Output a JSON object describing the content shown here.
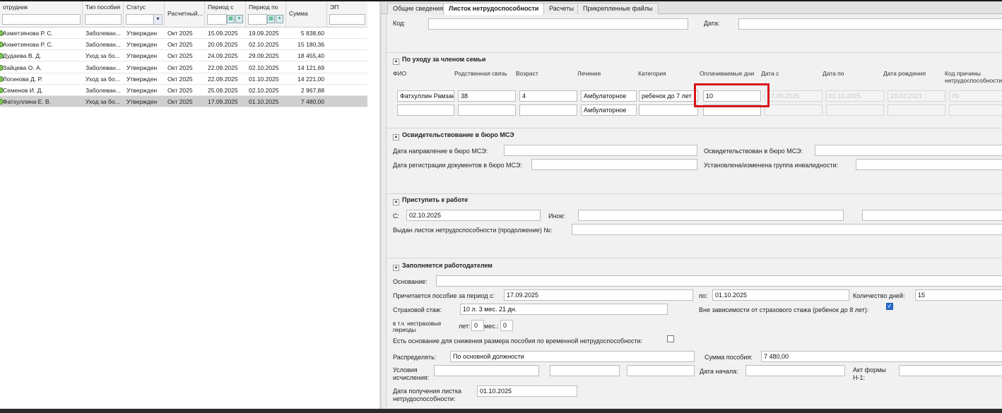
{
  "grid": {
    "columns": [
      "отрудник",
      "Тип пособия",
      "Статус",
      "Расчетный...",
      "Период с",
      "Период по",
      "Сумма",
      "ЭП"
    ],
    "rows": [
      {
        "employee": "Ахметзянова Р. С.",
        "type": "Заболеван...",
        "status": "Утвержден",
        "period": "Окт 2025",
        "from": "15.09.2025",
        "to": "19.09.2025",
        "sum": "5 838,60",
        "selected": false
      },
      {
        "employee": "Ахметзянова Р. С.",
        "type": "Заболеван...",
        "status": "Утвержден",
        "period": "Окт 2025",
        "from": "20.09.2025",
        "to": "02.10.2025",
        "sum": "15 180,36",
        "selected": false
      },
      {
        "employee": "Дудаева В. Д.",
        "type": "Уход за бо...",
        "status": "Утвержден",
        "period": "Окт 2025",
        "from": "24.09.2025",
        "to": "29.09.2025",
        "sum": "18 455,40",
        "selected": false
      },
      {
        "employee": "Зайцева О. А.",
        "type": "Заболеван...",
        "status": "Утвержден",
        "period": "Окт 2025",
        "from": "22.09.2025",
        "to": "02.10.2025",
        "sum": "14 121,69",
        "selected": false
      },
      {
        "employee": "Логинова Д. Р.",
        "type": "Уход за бо...",
        "status": "Утвержден",
        "period": "Окт 2025",
        "from": "22.09.2025",
        "to": "01.10.2025",
        "sum": "14 221,00",
        "selected": false
      },
      {
        "employee": "Семенов И. Д.",
        "type": "Заболеван...",
        "status": "Утвержден",
        "period": "Окт 2025",
        "from": "25.09.2025",
        "to": "02.10.2025",
        "sum": "2 967,88",
        "selected": false
      },
      {
        "employee": "Фатхуллина Е. В.",
        "type": "Уход за бо...",
        "status": "Утвержден",
        "period": "Окт 2025",
        "from": "17.09.2025",
        "to": "01.10.2025",
        "sum": "7 480,00",
        "selected": true
      }
    ]
  },
  "tabs": [
    "Общие сведения",
    "Листок нетрудоспособности",
    "Расчеты",
    "Прикрепленные файлы"
  ],
  "form": {
    "code_label": "Код:",
    "date_label": "Дата:",
    "family": {
      "title": "По уходу за членом семьи",
      "headers": {
        "fio": "ФИО",
        "relation": "Родственная связь",
        "age": "Возраст",
        "treatment": "Лечение",
        "category": "Категория",
        "paid_days": "Оплачиваемые дни",
        "date_from": "Дата с",
        "date_to": "Дата по",
        "birth": "Дата рождения",
        "reason_1": "Код причины",
        "reason_2": "нетрудоспособности"
      },
      "row1": {
        "fio": "Фатхуллин Рамзан",
        "relation": "38",
        "age": "4",
        "treatment": "Амбулаторное",
        "category": "ребенок до 7 лет",
        "paid_days": "10",
        "date_from": "17.09.2025",
        "date_to": "01.10.2025",
        "birth": "23.02.2021",
        "reason": "09"
      },
      "row2": {
        "treatment": "Амбулаторное"
      }
    },
    "mse": {
      "title": "Освидетельствование в бюро МСЭ",
      "sent_label": "Дата направление в бюро МСЭ:",
      "examined_label": "Освидетельствован в бюро МСЭ:",
      "reg_label": "Дата регистрации документов в бюро МСЭ:",
      "group_label": "Установлена/изменена группа инвалидности:"
    },
    "work": {
      "title": "Приступить к работе",
      "from_label": "С:",
      "from_value": "02.10.2025",
      "other_label": "Иное:",
      "continuation_label": "Выдан листок нетрудоспособности (продолжение) №:"
    },
    "employer": {
      "title": "Заполняется работодателем",
      "basis_label": "Основание:",
      "period_label": "Причитается пособие за период с:",
      "period_from": "17.09.2025",
      "period_to_label": "по:",
      "period_to": "01.10.2025",
      "days_label": "Количество дней:",
      "days": "15",
      "insurance_label": "Страховой стаж:",
      "insurance_value": "10 л. 3 мес. 21 дн.",
      "regardless_label": "Вне зависимости от страхового стажа (ребенок до 8 лет):",
      "regardless_checked": true,
      "noninsurance_line1": "в т.ч. нестраховые",
      "noninsurance_line2": "периоды",
      "years_label": "лет:",
      "years_value": "0",
      "months_label": "мес.:",
      "months_value": "0",
      "reduce_label": "Есть основание для снижения размера пособия по временной нетрудоспособности:",
      "reduce_checked": false,
      "distribute_label": "Распределять:",
      "distribute_value": "По основной должности",
      "sum_label": "Сумма пособия:",
      "sum_value": "7 480,00",
      "conditions_line1": "Условия",
      "conditions_line2": "исчисления:",
      "start_label": "Дата начала:",
      "act_line1": "Акт формы",
      "act_line2": "Н-1:",
      "received_line1": "Дата получения листка",
      "received_line2": "нетрудоспособности:",
      "received_value": "01.10.2025"
    }
  },
  "colors": {
    "highlight": "#d8161a",
    "selected_row": "#cfcfcf",
    "checkbox": "#2d6fd6"
  }
}
